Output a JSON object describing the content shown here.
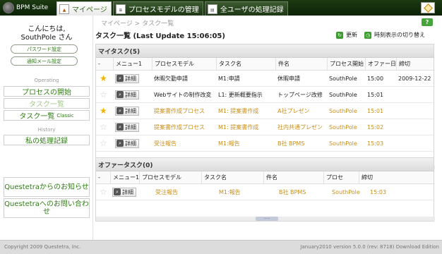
{
  "app": {
    "logo_text": "BPM Suite"
  },
  "tabs": [
    {
      "label": "マイページ",
      "icon": "mypage-icon",
      "active": true
    },
    {
      "label": "プロセスモデルの管理",
      "icon": "process-model-icon",
      "active": false
    },
    {
      "label": "全ユーザの処理記録",
      "icon": "records-icon",
      "active": false
    }
  ],
  "sidebar": {
    "greeting_line1": "こんにちは,",
    "greeting_line2": "SouthPole さん",
    "password_button": "パスワード設定",
    "email_button": "通知メール設定",
    "operating_label": "Operating",
    "nav": {
      "start_process": "プロセスの開始",
      "task_list": "タスク一覧",
      "task_list_classic": "タスク一覧",
      "classic_suffix": "Classic"
    },
    "history_label": "History",
    "my_records": "私の処理記録",
    "info_from": "Questetraからのお知らせ",
    "contact": "Questetraへのお問い合わせ"
  },
  "main": {
    "breadcrumb": "マイページ > タスク一覧",
    "help": "?",
    "panel_title": "タスク一覧 (Last Update 15:06:05)",
    "refresh_label": "更新",
    "clock_toggle_label": "時刻表示の切り替え",
    "my_tasks": {
      "title": "マイタスク(5)",
      "headers": [
        "-",
        "メニュー1",
        "プロセスモデル",
        "タスク名",
        "件名",
        "プロセス開始",
        "オファー日時",
        "締切"
      ],
      "detail_label": "詳細",
      "rows": [
        {
          "star": true,
          "process_model": "休暇欠勤申請",
          "task": "M1:申請",
          "subject": "休暇申請",
          "starter": "SouthPole",
          "offer": "15:00",
          "deadline": "2009-12-22",
          "highlight": false
        },
        {
          "star": false,
          "process_model": "Webサイトの制作改変",
          "task": "L1: 更新概要指示",
          "subject": "トップページ改修",
          "starter": "SouthPole",
          "offer": "15:01",
          "deadline": "",
          "highlight": false
        },
        {
          "star": true,
          "process_model": "提案書作成プロセス",
          "task": "M1: 提案書作成",
          "subject": "A社プレゼン",
          "starter": "SouthPole",
          "offer": "15:01",
          "deadline": "",
          "highlight": true
        },
        {
          "star": false,
          "process_model": "提案書作成プロセス",
          "task": "M1: 提案書作成",
          "subject": "社内共通プレゼン",
          "starter": "SouthPole",
          "offer": "15:02",
          "deadline": "",
          "highlight": true
        },
        {
          "star": false,
          "process_model": "受注報告",
          "task": "M1:報告",
          "subject": "B社 BPMS",
          "starter": "SouthPole",
          "offer": "15:03",
          "deadline": "",
          "highlight": true
        }
      ]
    },
    "offer_tasks": {
      "title": "オファータスク(0)",
      "headers": [
        "-",
        "メニュー1",
        "プロセスモデル",
        "タスク名",
        "件名",
        "プロセ",
        "締切"
      ],
      "rows": [
        {
          "star": false,
          "process_model": "受注報告",
          "task": "M1:報告",
          "subject": "B社 BPMS",
          "starter": "SouthPole",
          "offer": "15:03",
          "highlight": true
        }
      ]
    },
    "grip_label": "....."
  },
  "footer": {
    "copyright": "Copyright 2009 Questetra, Inc.",
    "version": "January2010 version 5.0.0 (rev: 8718) Download Edition"
  },
  "colors": {
    "brand_green": "#2e7d12",
    "topbar": "#14300c",
    "highlight_text": "#c98f1a",
    "star": "#f1b400"
  }
}
